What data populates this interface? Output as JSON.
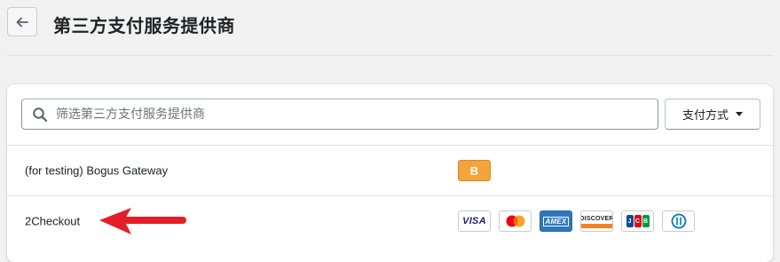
{
  "header": {
    "title": "第三方支付服务提供商",
    "back_icon": "arrow-left-icon"
  },
  "filter": {
    "search_placeholder": "筛选第三方支付服务提供商",
    "search_icon": "search-icon",
    "payment_methods_label": "支付方式"
  },
  "providers": [
    {
      "name": "(for testing) Bogus Gateway",
      "badges": [
        {
          "label": "B",
          "color": "#f3a43a"
        }
      ]
    },
    {
      "name": "2Checkout",
      "badges": [
        {
          "label": "VISA"
        },
        {
          "label": "Mastercard"
        },
        {
          "label": "AMEX"
        },
        {
          "label": "DISCOVER"
        },
        {
          "label": "JCB"
        },
        {
          "label": "Diners Club"
        }
      ]
    }
  ],
  "annotation": {
    "arrow_color": "#e41e26"
  }
}
